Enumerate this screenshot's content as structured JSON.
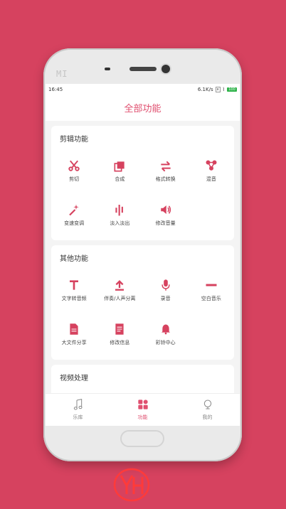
{
  "status": {
    "time": "16:45",
    "speed": "6.1K/s",
    "sim": "x",
    "battery": "100"
  },
  "brand": "MI",
  "header": {
    "title": "全部功能"
  },
  "sections": [
    {
      "title": "剪辑功能",
      "items": [
        {
          "label": "剪切",
          "icon": "scissors-icon"
        },
        {
          "label": "合成",
          "icon": "merge-icon"
        },
        {
          "label": "格式转换",
          "icon": "swap-icon"
        },
        {
          "label": "混音",
          "icon": "mix-icon"
        },
        {
          "label": "变速变调",
          "icon": "magic-wand-icon"
        },
        {
          "label": "淡入淡出",
          "icon": "fade-icon"
        },
        {
          "label": "修改音量",
          "icon": "volume-icon"
        }
      ]
    },
    {
      "title": "其他功能",
      "items": [
        {
          "label": "文字转音频",
          "icon": "text-icon"
        },
        {
          "label": "伴奏/人声分离",
          "icon": "upload-icon"
        },
        {
          "label": "录音",
          "icon": "microphone-icon"
        },
        {
          "label": "空白音乐",
          "icon": "minus-icon"
        },
        {
          "label": "大文件分享",
          "icon": "file-icon"
        },
        {
          "label": "修改信息",
          "icon": "document-icon"
        },
        {
          "label": "彩铃中心",
          "icon": "bell-icon"
        }
      ]
    },
    {
      "title": "视频处理"
    }
  ],
  "tabs": [
    {
      "label": "乐库",
      "icon": "music-note-icon"
    },
    {
      "label": "功能",
      "icon": "grid-icon"
    },
    {
      "label": "我的",
      "icon": "profile-icon"
    }
  ],
  "colors": {
    "accent": "#e05070",
    "background": "#d6425f"
  }
}
